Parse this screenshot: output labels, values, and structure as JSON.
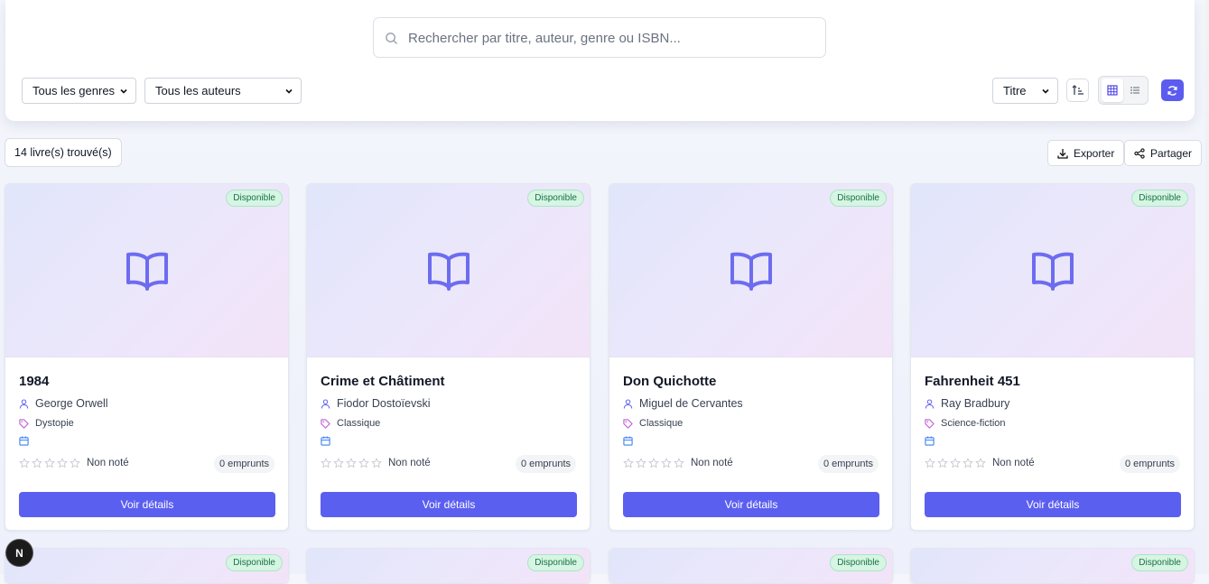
{
  "search": {
    "placeholder": "Rechercher par titre, auteur, genre ou ISBN..."
  },
  "filters": {
    "genre_select": "Tous les genres",
    "author_select": "Tous les auteurs",
    "sort_select": "Titre"
  },
  "results": {
    "count_text": "14 livre(s) trouvé(s)",
    "export_label": "Exporter",
    "share_label": "Partager"
  },
  "colors": {
    "accent": "#5b5ff0",
    "badge_bg": "#d6f5e3",
    "badge_text": "#177245",
    "icon_author": "#6b6bf0",
    "icon_genre": "#c05bd9",
    "icon_date": "#3b82f6"
  },
  "icons": [
    "search-icon",
    "chevron-down-icon",
    "sort-ascending-icon",
    "grid-view-icon",
    "list-view-icon",
    "refresh-icon",
    "download-icon",
    "share-icon",
    "book-open-icon",
    "user-icon",
    "tag-icon",
    "calendar-icon",
    "star-icon"
  ],
  "books": [
    {
      "status": "Disponible",
      "title": "1984",
      "author": "George Orwell",
      "genre": "Dystopie",
      "rating_text": "Non noté",
      "loans": "0 emprunts",
      "button": "Voir détails"
    },
    {
      "status": "Disponible",
      "title": "Crime et Châtiment",
      "author": "Fiodor Dostoïevski",
      "genre": "Classique",
      "rating_text": "Non noté",
      "loans": "0 emprunts",
      "button": "Voir détails"
    },
    {
      "status": "Disponible",
      "title": "Don Quichotte",
      "author": "Miguel de Cervantes",
      "genre": "Classique",
      "rating_text": "Non noté",
      "loans": "0 emprunts",
      "button": "Voir détails"
    },
    {
      "status": "Disponible",
      "title": "Fahrenheit 451",
      "author": "Ray Bradbury",
      "genre": "Science-fiction",
      "rating_text": "Non noté",
      "loans": "0 emprunts",
      "button": "Voir détails"
    }
  ],
  "partial_cards": [
    {
      "status": "Disponible"
    },
    {
      "status": "Disponible"
    },
    {
      "status": "Disponible"
    },
    {
      "status": "Disponible"
    }
  ],
  "dev_badge": "N"
}
